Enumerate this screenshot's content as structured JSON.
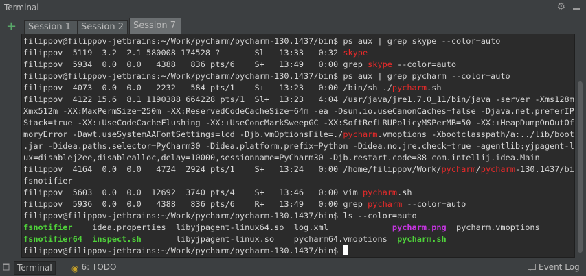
{
  "window": {
    "title": "Terminal"
  },
  "colors": {
    "background": "#2b2b2b",
    "text": "#d6d6d6",
    "match": "#e82a2a",
    "executable": "#4fd23a",
    "image": "#c535e0",
    "add": "#59a869"
  },
  "tabs": [
    {
      "label": "Session 1",
      "active": false
    },
    {
      "label": "Session 2",
      "active": false
    },
    {
      "label": "Session 7",
      "active": true
    }
  ],
  "terminal": {
    "lines": [
      [
        {
          "t": "filippov@filippov-jetbrains:~/Work/pycharm/pycharm-130.1437/bin$ ps aux | grep skype --color=auto"
        }
      ],
      [
        {
          "t": "filippov  5119  3.2  2.1 580008 174528 ?       Sl   13:33   0:32 "
        },
        {
          "t": "skype",
          "c": "red"
        }
      ],
      [
        {
          "t": "filippov  5934  0.0  0.0   4388   836 pts/6    S+   13:49   0:00 grep "
        },
        {
          "t": "skype",
          "c": "red"
        },
        {
          "t": " --color=auto"
        }
      ],
      [
        {
          "t": "filippov@filippov-jetbrains:~/Work/pycharm/pycharm-130.1437/bin$ ps aux | grep pycharm --color=auto"
        }
      ],
      [
        {
          "t": "filippov  4073  0.0  0.0   2232   584 pts/1    S+   13:23   0:00 /bin/sh ./"
        },
        {
          "t": "pycharm",
          "c": "red"
        },
        {
          "t": ".sh"
        }
      ],
      [
        {
          "t": "filippov  4122 15.6  8.1 1190388 664228 pts/1  Sl+  13:23   4:04 /usr/java/jre1.7.0_11/bin/java -server -Xms128m -"
        }
      ],
      [
        {
          "t": "Xmx512m -XX:MaxPermSize=250m -XX:ReservedCodeCacheSize=64m -ea -Dsun.io.useCanonCaches=false -Djava.net.preferIPv4"
        }
      ],
      [
        {
          "t": "Stack=true -XX:+UseCodeCacheFlushing -XX:+UseConcMarkSweepGC -XX:SoftRefLRUPolicyMSPerMB=50 -XX:+HeapDumpOnOutOfMe"
        }
      ],
      [
        {
          "t": "moryError -Dawt.useSystemAAFontSettings=lcd -Djb.vmOptionsFile=./"
        },
        {
          "t": "pycharm",
          "c": "red"
        },
        {
          "t": ".vmoptions -Xbootclasspath/a:../lib/boot"
        }
      ],
      [
        {
          "t": ".jar -Didea.paths.selector=PyCharm30 -Didea.platform.prefix=Python -Didea.no.jre.check=true -agentlib:yjpagent-lin"
        }
      ],
      [
        {
          "t": "ux=disablej2ee,disablealloc,delay=10000,sessionname=PyCharm30 -Djb.restart.code=88 com.intellij.idea.Main"
        }
      ],
      [
        {
          "t": "filippov  4164  0.0  0.0   4724  2924 pts/1    S+   13:24   0:00 /home/filippov/Work/"
        },
        {
          "t": "pycharm",
          "c": "red"
        },
        {
          "t": "/"
        },
        {
          "t": "pycharm",
          "c": "red"
        },
        {
          "t": "-130.1437/bin/"
        }
      ],
      [
        {
          "t": "fsnotifier"
        }
      ],
      [
        {
          "t": "filippov  5603  0.0  0.0  12692  3740 pts/4    S+   13:46   0:00 vim "
        },
        {
          "t": "pycharm",
          "c": "red"
        },
        {
          "t": ".sh"
        }
      ],
      [
        {
          "t": "filippov  5936  0.0  0.0   4388   836 pts/6    R+   13:49   0:00 grep "
        },
        {
          "t": "pycharm",
          "c": "red"
        },
        {
          "t": " --color=auto"
        }
      ],
      [
        {
          "t": "filippov@filippov-jetbrains:~/Work/pycharm/pycharm-130.1437/bin$ ls --color=auto"
        }
      ],
      [
        {
          "t": "fsnotifier",
          "c": "grn"
        },
        {
          "t": "    idea.properties  libyjpagent-linux64.so  log.xml             "
        },
        {
          "t": "pycharm.png",
          "c": "mag"
        },
        {
          "t": "  pycharm.vmoptions"
        }
      ],
      [
        {
          "t": "fsnotifier64",
          "c": "grn"
        },
        {
          "t": "  "
        },
        {
          "t": "inspect.sh",
          "c": "grn"
        },
        {
          "t": "       libyjpagent-linux.so    pycharm64.vmoptions  "
        },
        {
          "t": "pycharm.sh",
          "c": "grn"
        }
      ],
      [
        {
          "t": "filippov@filippov-jetbrains:~/Work/pycharm/pycharm-130.1437/bin$ "
        },
        {
          "cursor": true
        }
      ]
    ]
  },
  "statusbar": {
    "terminal_label": "Terminal",
    "todo_mnemonic": "6",
    "todo_label": ": TODO",
    "eventlog_label": "Event Log"
  },
  "icons": {
    "add": "plus-icon",
    "settings": "gear-icon",
    "hide": "hide-icon",
    "todo": "todo-icon",
    "terminal": "terminal-icon",
    "eventlog": "event-log-icon"
  }
}
